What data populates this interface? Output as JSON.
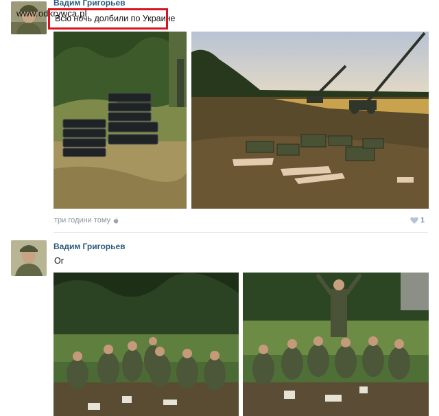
{
  "watermark": "www.odkrywca.pl",
  "posts": [
    {
      "author": "Вадим Григорьев",
      "text": "Всю ночь долбили по Украине",
      "timestamp": "три години тому",
      "likes": "1"
    },
    {
      "author": "Вадим Григорьев",
      "text": "Ог"
    }
  ],
  "icons": {
    "like": "heart-icon",
    "device": "apple-icon"
  },
  "colors": {
    "author_link": "#2b587a",
    "highlight_box": "#d9141e",
    "meta": "#8a939c"
  }
}
